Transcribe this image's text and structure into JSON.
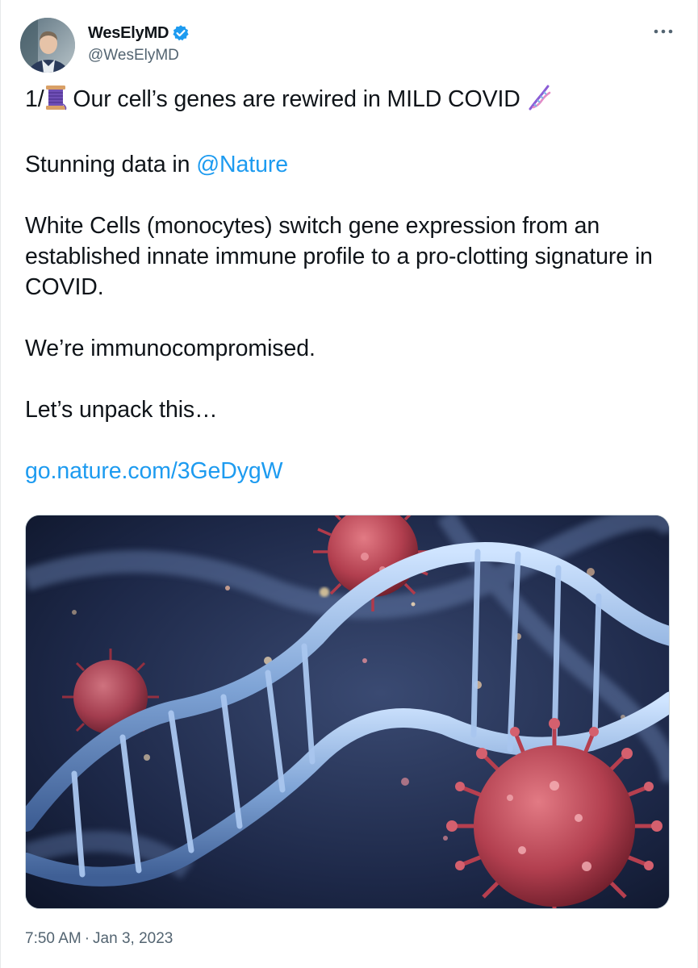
{
  "author": {
    "display_name": "WesElyMD",
    "handle": "@WesElyMD",
    "verified_icon": "verified-badge-icon",
    "avatar_icon": "profile-photo"
  },
  "menu": {
    "more_icon": "more-dots-icon"
  },
  "tweet": {
    "line1_prefix": "1/",
    "line1_text": " Our cell’s genes are rewired in MILD COVID ",
    "emoji1": "spool-of-thread-emoji",
    "emoji2": "dna-emoji",
    "para2_text": "Stunning data in ",
    "para2_mention": "@Nature",
    "para3": "White Cells (monocytes) switch gene expression from an established innate immune profile to a pro-clotting signature in COVID.",
    "para4": "We’re immunocompromised.",
    "para5": "Let’s unpack this…",
    "link": "go.nature.com/3GeDygW"
  },
  "media": {
    "description_icon": "dna-virus-illustration"
  },
  "meta": {
    "time": "7:50 AM",
    "separator": "·",
    "date": "Jan 3, 2023"
  },
  "colors": {
    "link": "#1d9bf0",
    "verified": "#1d9bf0",
    "secondary_text": "#536471"
  }
}
